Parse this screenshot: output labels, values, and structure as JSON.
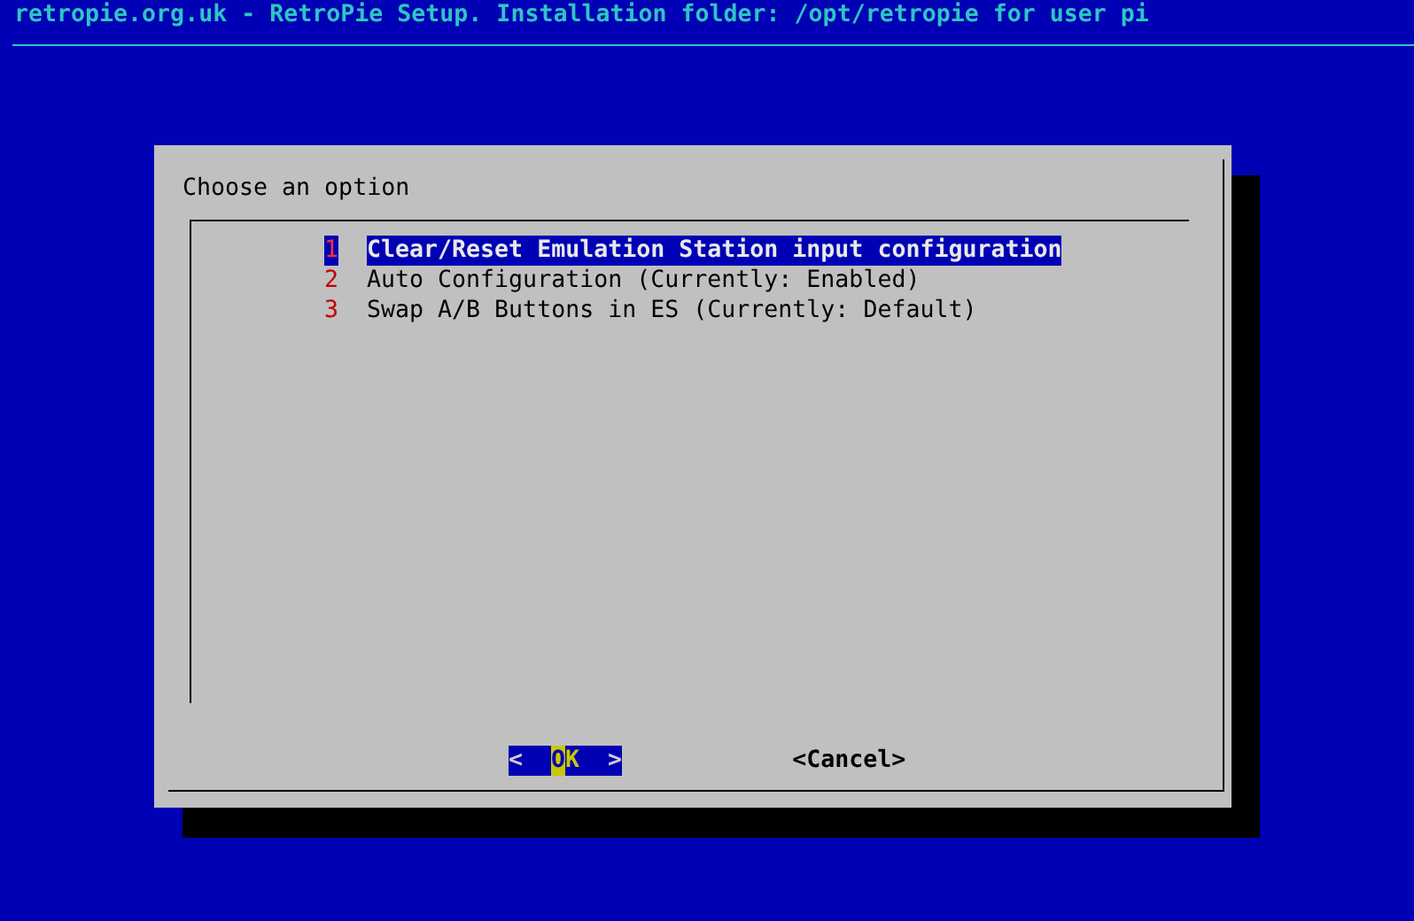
{
  "header": {
    "title": "retropie.org.uk - RetroPie Setup. Installation folder: /opt/retropie for user pi"
  },
  "dialog": {
    "prompt": "Choose an option",
    "menu": [
      {
        "tag": "1",
        "label": "Clear/Reset Emulation Station input configuration",
        "selected": true
      },
      {
        "tag": "2",
        "label": "Auto Configuration (Currently: Enabled)",
        "selected": false
      },
      {
        "tag": "3",
        "label": "Swap A/B Buttons in ES (Currently: Default)",
        "selected": false
      }
    ],
    "buttons": [
      {
        "open": "<",
        "label": "OK",
        "close": ">",
        "selected": true
      },
      {
        "open": "<",
        "label": "Cancel",
        "close": ">",
        "selected": false
      }
    ]
  }
}
